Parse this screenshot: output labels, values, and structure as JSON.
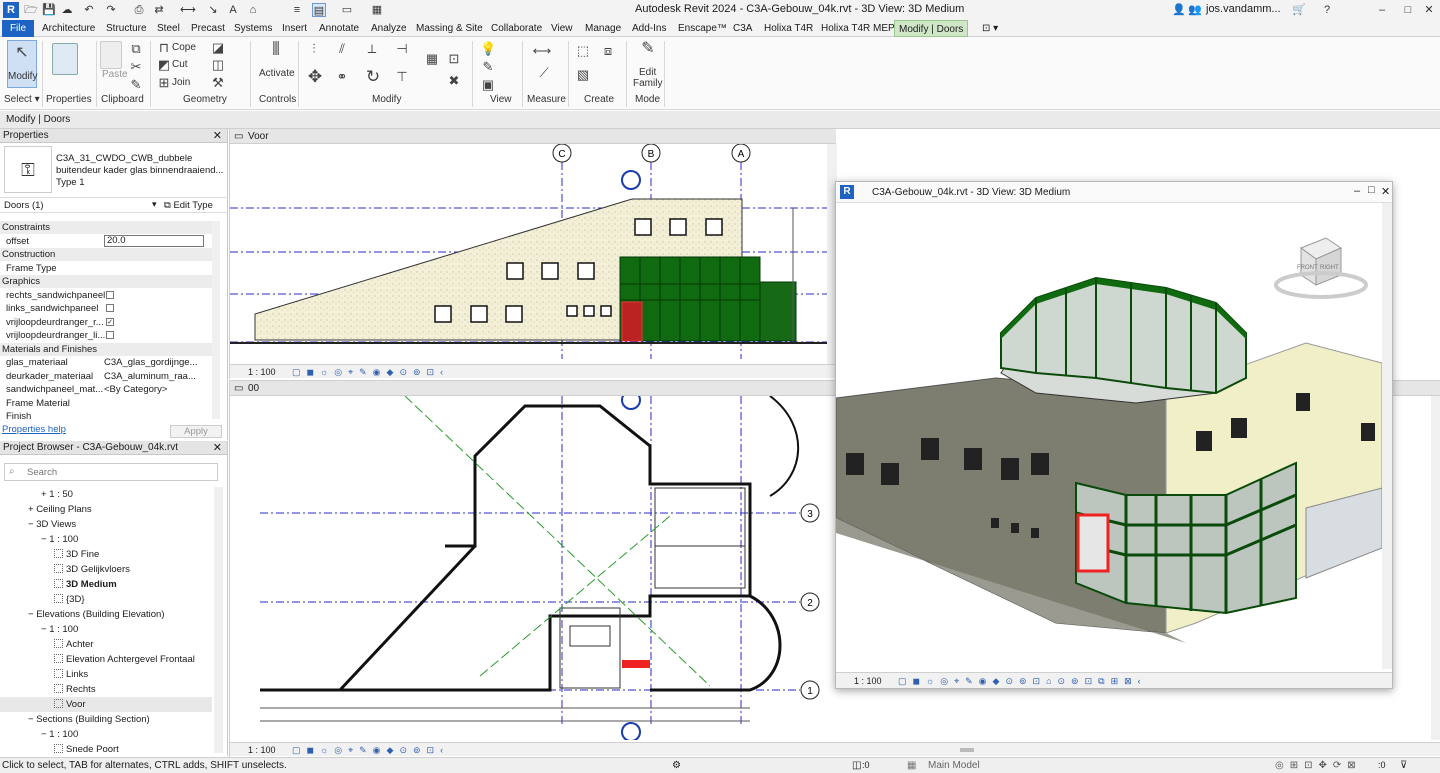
{
  "app": {
    "title": "Autodesk Revit 2024 - C3A-Gebouw_04k.rvt - 3D View: 3D Medium",
    "logo": "R",
    "user": "jos.vandamm...",
    "window_controls": [
      "–",
      "□",
      "✕"
    ]
  },
  "tabs": [
    {
      "label": "File"
    },
    {
      "label": "Architecture"
    },
    {
      "label": "Structure"
    },
    {
      "label": "Steel"
    },
    {
      "label": "Precast"
    },
    {
      "label": "Systems"
    },
    {
      "label": "Insert"
    },
    {
      "label": "Annotate"
    },
    {
      "label": "Analyze"
    },
    {
      "label": "Massing & Site"
    },
    {
      "label": "Collaborate"
    },
    {
      "label": "View"
    },
    {
      "label": "Manage"
    },
    {
      "label": "Add-Ins"
    },
    {
      "label": "Enscape™"
    },
    {
      "label": "C3A"
    },
    {
      "label": "Holixa T4R"
    },
    {
      "label": "Holixa T4R MEP"
    },
    {
      "label": "Modify | Doors"
    }
  ],
  "ribbon": {
    "select": {
      "modify": "Modify",
      "label": "Select ▾"
    },
    "properties": "Properties",
    "clipboard": {
      "paste": "Paste",
      "label": "Clipboard"
    },
    "geometry": {
      "cope": "Cope",
      "cut": "Cut",
      "join": "Join",
      "label": "Geometry"
    },
    "controls": {
      "activate": "Activate",
      "label": "Controls"
    },
    "modify": "Modify",
    "view": "View",
    "measure": "Measure",
    "create": "Create",
    "mode": {
      "edit1": "Edit",
      "edit2": "Family",
      "label": "Mode"
    }
  },
  "context_bar": "Modify | Doors",
  "properties_panel": {
    "title": "Properties",
    "type_line1": "C3A_31_CWDO_CWB_dubbele",
    "type_line2": "buitendeur kader glas binnendraaiend...",
    "type_line3": "Type 1",
    "filter": "Doors (1)",
    "edit_type": "Edit Type",
    "rows": [
      {
        "k": "Constraints",
        "group": true
      },
      {
        "k": "offset",
        "v": "20.0"
      },
      {
        "k": "Construction",
        "group": true
      },
      {
        "k": "Frame Type",
        "v": ""
      },
      {
        "k": "Graphics",
        "group": true
      },
      {
        "k": "rechts_sandwichpaneel",
        "v": "",
        "check": false
      },
      {
        "k": "links_sandwichpaneel",
        "v": "",
        "check": false
      },
      {
        "k": "vrijloopdeurdranger_r...",
        "v": "",
        "check": true
      },
      {
        "k": "vrijloopdeurdranger_li...",
        "v": "",
        "check": false
      },
      {
        "k": "Materials and Finishes",
        "group": true
      },
      {
        "k": "glas_materiaal",
        "v": "C3A_glas_gordijnge..."
      },
      {
        "k": "deurkader_materiaal",
        "v": "C3A_aluminum_raa..."
      },
      {
        "k": "sandwichpaneel_mat...",
        "v": "<By Category>"
      },
      {
        "k": "Frame Material",
        "v": ""
      },
      {
        "k": "Finish",
        "v": ""
      }
    ],
    "help": "Properties help",
    "apply": "Apply"
  },
  "browser": {
    "title": "Project Browser - C3A-Gebouw_04k.rvt",
    "search_placeholder": "Search",
    "items": [
      {
        "label": "1 : 50",
        "indent": 3,
        "exp": "+"
      },
      {
        "label": "Ceiling Plans",
        "indent": 2,
        "exp": "+"
      },
      {
        "label": "3D Views",
        "indent": 2,
        "exp": "−"
      },
      {
        "label": "1 : 100",
        "indent": 3,
        "exp": "−"
      },
      {
        "label": "3D Fine",
        "indent": 4,
        "view": true
      },
      {
        "label": "3D Gelijkvloers",
        "indent": 4,
        "view": true
      },
      {
        "label": "3D Medium",
        "indent": 4,
        "view": true,
        "bold": true
      },
      {
        "label": "{3D}",
        "indent": 4,
        "view": true
      },
      {
        "label": "Elevations (Building Elevation)",
        "indent": 2,
        "exp": "−"
      },
      {
        "label": "1 : 100",
        "indent": 3,
        "exp": "−"
      },
      {
        "label": "Achter",
        "indent": 4,
        "view": true
      },
      {
        "label": "Elevation Achtergevel Frontaal",
        "indent": 4,
        "view": true
      },
      {
        "label": "Links",
        "indent": 4,
        "view": true
      },
      {
        "label": "Rechts",
        "indent": 4,
        "view": true
      },
      {
        "label": "Voor",
        "indent": 4,
        "view": true,
        "selected": true
      },
      {
        "label": "Sections (Building Section)",
        "indent": 2,
        "exp": "−"
      },
      {
        "label": "1 : 100",
        "indent": 3,
        "exp": "−"
      },
      {
        "label": "Snede Poort",
        "indent": 4,
        "view": true
      }
    ]
  },
  "view_voor": {
    "title": "Voor",
    "scale": "1 : 100",
    "grids": [
      "C",
      "B",
      "A"
    ]
  },
  "view_00": {
    "title": "00",
    "scale": "1 : 100",
    "grids": [
      "3",
      "2",
      "1"
    ]
  },
  "view_3d": {
    "title": "C3A-Gebouw_04k.rvt - 3D View: 3D Medium",
    "scale": "1 : 100",
    "cube_front": "FRONT",
    "cube_right": "RIGHT"
  },
  "status": {
    "hint": "Click to select, TAB for alternates, CTRL adds, SHIFT unselects.",
    "model": "Main Model",
    "zero": ":0"
  },
  "colors": {
    "accent": "#1d63c3",
    "glass": "#1f6b1a",
    "wall": "#8a8a7c",
    "context_tab": "#cfe7c7"
  }
}
